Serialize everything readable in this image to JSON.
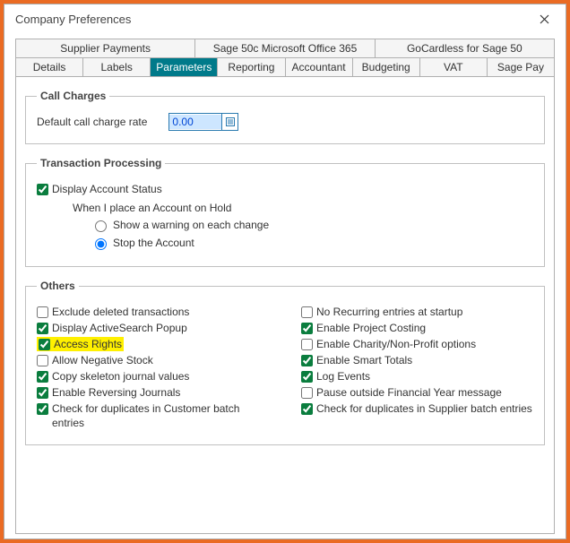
{
  "window": {
    "title": "Company Preferences"
  },
  "tabsTop": [
    {
      "label": "Supplier Payments"
    },
    {
      "label": "Sage 50c Microsoft Office 365"
    },
    {
      "label": "GoCardless for Sage 50"
    }
  ],
  "tabsBottom": [
    {
      "label": "Details"
    },
    {
      "label": "Labels"
    },
    {
      "label": "Parameters"
    },
    {
      "label": "Reporting"
    },
    {
      "label": "Accountant"
    },
    {
      "label": "Budgeting"
    },
    {
      "label": "VAT"
    },
    {
      "label": "Sage Pay"
    }
  ],
  "callCharges": {
    "legend": "Call Charges",
    "label": "Default call charge rate",
    "value": "0.00"
  },
  "txn": {
    "legend": "Transaction Processing",
    "displayStatus": "Display Account Status",
    "onHoldLabel": "When I place an Account on Hold",
    "optWarn": "Show a warning on each change",
    "optStop": "Stop the Account"
  },
  "others": {
    "legend": "Others",
    "left0": "Exclude deleted transactions",
    "left1": "Display ActiveSearch Popup",
    "left2": "Access Rights",
    "left3": "Allow Negative Stock",
    "left4": "Copy skeleton journal values",
    "left5": "Enable Reversing Journals",
    "left6": "Check for duplicates in Customer batch entries",
    "right0": "No Recurring entries at startup",
    "right1": "Enable Project Costing",
    "right2": "Enable Charity/Non-Profit options",
    "right3": "Enable Smart Totals",
    "right4": "Log Events",
    "right5": "Pause outside Financial Year message",
    "right6": "Check for duplicates in Supplier batch entries"
  }
}
